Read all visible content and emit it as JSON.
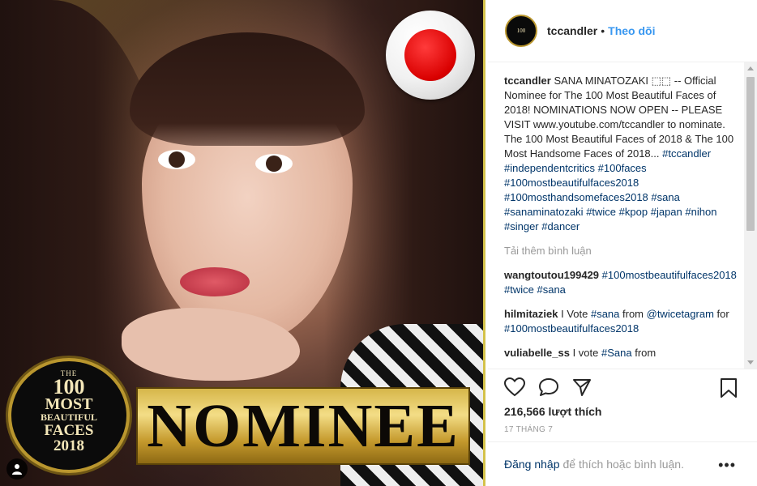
{
  "photo": {
    "nominee_label": "NOMINEE",
    "badge": {
      "line1": "THE",
      "line2": "100",
      "line3": "MOST",
      "line4": "BEAUTIFUL",
      "line5": "FACES",
      "line6": "2018"
    },
    "flag": "japan-flag"
  },
  "header": {
    "username": "tccandler",
    "separator": "•",
    "follow_label": "Theo dõi"
  },
  "caption": {
    "username": "tccandler",
    "text": "SANA MINATOZAKI ⬚⬚ -- Official Nominee for The 100 Most Beautiful Faces of 2018! NOMINATIONS NOW OPEN -- PLEASE VISIT www.youtube.com/tccandler to nominate. The 100 Most Beautiful Faces of 2018 & The 100 Most Handsome Faces of 2018...",
    "hashtags": [
      "#tccandler",
      "#independentcritics",
      "#100faces",
      "#100mostbeautifulfaces2018",
      "#100mosthandsomefaces2018",
      "#sana",
      "#sanaminatozaki",
      "#twice",
      "#kpop",
      "#japan",
      "#nihon",
      "#singer",
      "#dancer"
    ]
  },
  "load_more": "Tải thêm bình luận",
  "comments": [
    {
      "username": "wangtoutou199429",
      "parts": [
        {
          "t": "tag",
          "v": "#100mostbeautifulfaces2018"
        },
        {
          "t": "text",
          "v": " "
        },
        {
          "t": "tag",
          "v": "#twice"
        },
        {
          "t": "text",
          "v": " "
        },
        {
          "t": "tag",
          "v": "#sana"
        }
      ]
    },
    {
      "username": "hilmitaziek",
      "parts": [
        {
          "t": "text",
          "v": "I Vote "
        },
        {
          "t": "tag",
          "v": "#sana"
        },
        {
          "t": "text",
          "v": " from "
        },
        {
          "t": "tag",
          "v": "@twicetagram"
        },
        {
          "t": "text",
          "v": " for "
        },
        {
          "t": "tag",
          "v": "#100mostbeautifulfaces2018"
        }
      ]
    },
    {
      "username": "vuliabelle_ss",
      "parts": [
        {
          "t": "text",
          "v": "I vote "
        },
        {
          "t": "tag",
          "v": "#Sana"
        },
        {
          "t": "text",
          "v": " from"
        }
      ]
    }
  ],
  "actions": {
    "like_icon": "heart-icon",
    "comment_icon": "comment-icon",
    "share_icon": "share-icon",
    "save_icon": "bookmark-icon"
  },
  "likes": "216,566 lượt thích",
  "date": "17 THÁNG 7",
  "login": {
    "link": "Đăng nhập",
    "text": "để thích hoặc bình luận.",
    "more": "•••"
  }
}
